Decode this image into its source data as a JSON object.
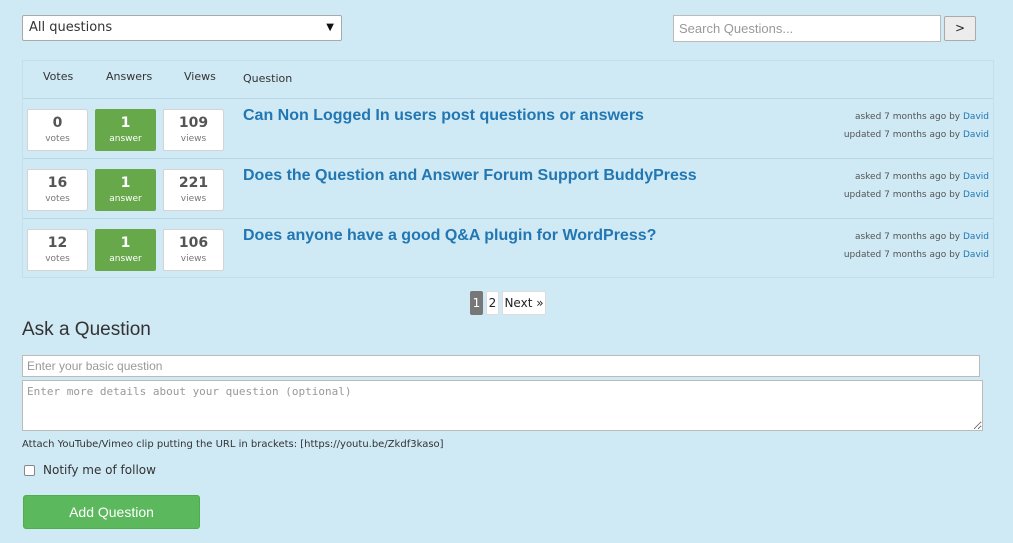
{
  "filter": {
    "selected": "All questions",
    "caret": "▼"
  },
  "search": {
    "placeholder": "Search Questions...",
    "button_label": ">"
  },
  "table": {
    "headers": {
      "votes": "Votes",
      "answers": "Answers",
      "views": "Views",
      "question": "Question"
    },
    "rows": [
      {
        "votes": "0",
        "votes_label": "votes",
        "answers": "1",
        "answers_label": "answer",
        "views": "109",
        "views_label": "views",
        "title": "Can Non Logged In users post questions or answers",
        "asked_text": "asked 7 months ago by",
        "asked_by": "David",
        "updated_text": "updated 7 months ago by",
        "updated_by": "David"
      },
      {
        "votes": "16",
        "votes_label": "votes",
        "answers": "1",
        "answers_label": "answer",
        "views": "221",
        "views_label": "views",
        "title": "Does the Question and Answer Forum Support BuddyPress",
        "asked_text": "asked 7 months ago by",
        "asked_by": "David",
        "updated_text": "updated 7 months ago by",
        "updated_by": "David"
      },
      {
        "votes": "12",
        "votes_label": "votes",
        "answers": "1",
        "answers_label": "answer",
        "views": "106",
        "views_label": "views",
        "title": "Does anyone have a good Q&A plugin for WordPress?",
        "asked_text": "asked 7 months ago by",
        "asked_by": "David",
        "updated_text": "updated 7 months ago by",
        "updated_by": "David"
      }
    ]
  },
  "pagination": {
    "current": "1",
    "page2": "2",
    "next": "Next »"
  },
  "ask": {
    "title": "Ask a Question",
    "basic_placeholder": "Enter your basic question",
    "details_placeholder": "Enter more details about your question (optional)",
    "attach_note": "Attach YouTube/Vimeo clip putting the URL in brackets: [https://youtu.be/Zkdf3kaso]",
    "notify_label": "Notify me of follow",
    "submit_label": "Add Question"
  },
  "colors": {
    "background": "#cfe9f5",
    "link": "#2277b3",
    "answered": "#67a94a",
    "button": "#5cb85c"
  }
}
